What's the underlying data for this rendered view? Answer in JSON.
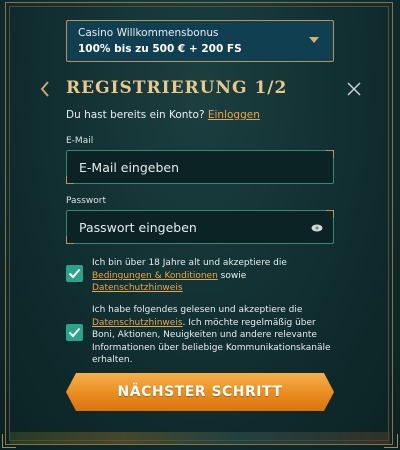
{
  "bonus": {
    "line1": "Casino Willkommensbonus",
    "line2": "100% bis zu 500 € + 200 FS"
  },
  "header": {
    "title": "REGISTRIERUNG 1/2"
  },
  "login": {
    "prompt": "Du hast bereits ein Konto?",
    "link": "Einloggen"
  },
  "form": {
    "email_label": "E-Mail",
    "email_placeholder": "E-Mail eingeben",
    "password_label": "Passwort",
    "password_placeholder": "Passwort eingeben"
  },
  "consent1": {
    "checked": true,
    "text_before": "Ich bin über 18 Jahre alt und akzeptiere die",
    "link1": "Bedingungen & Konditionen",
    "text_mid": " sowie",
    "link2": "Datenschutzhinweis"
  },
  "consent2": {
    "checked": true,
    "text_before": "Ich habe folgendes gelesen und akzeptiere die",
    "link": "Datenschutzhinweis",
    "text_after": ". Ich möchte regelmäßig über Boni, Aktionen, Neuigkeiten und andere relevante Informationen über beliebige Kommunikationskanäle erhalten."
  },
  "next_button": {
    "label": "NÄCHSTER SCHRITT"
  },
  "colors": {
    "accent_orange": "#e9a74a",
    "checkbox_teal": "#2aa38a",
    "title_gold": "#e9c88c"
  }
}
